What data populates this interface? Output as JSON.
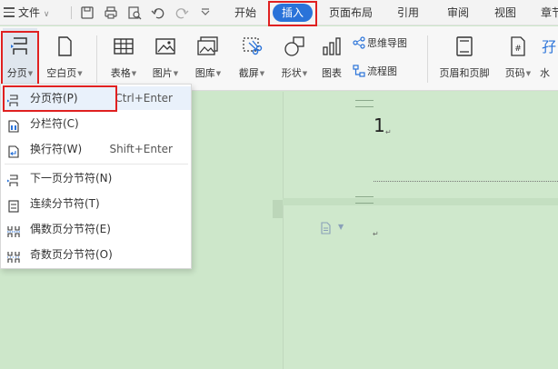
{
  "menubar": {
    "file_label": "文件",
    "tabs": [
      "开始",
      "插入",
      "页面布局",
      "引用",
      "审阅",
      "视图",
      "章节"
    ]
  },
  "ribbon": {
    "page_break": "分页",
    "blank_page": "空白页",
    "table": "表格",
    "picture": "图片",
    "gallery": "图库",
    "screenshot": "截屏",
    "shape": "形状",
    "chart": "图表",
    "mind_map": "思维导图",
    "flowchart": "流程图",
    "header_footer": "页眉和页脚",
    "page_number": "页码",
    "watermark": "水"
  },
  "dropdown": {
    "items": [
      {
        "label": "分页符(P)",
        "shortcut": "Ctrl+Enter"
      },
      {
        "label": "分栏符(C)",
        "shortcut": ""
      },
      {
        "label": "换行符(W)",
        "shortcut": "Shift+Enter"
      },
      {
        "label": "下一页分节符(N)",
        "shortcut": ""
      },
      {
        "label": "连续分节符(T)",
        "shortcut": ""
      },
      {
        "label": "偶数页分节符(E)",
        "shortcut": ""
      },
      {
        "label": "奇数页分节符(O)",
        "shortcut": ""
      }
    ]
  },
  "document": {
    "page_number_text": "1",
    "para_mark": "↵"
  },
  "colors": {
    "accent": "#2a73d9",
    "highlight_border": "#e02020",
    "doc_bg": "#cde7ca"
  }
}
